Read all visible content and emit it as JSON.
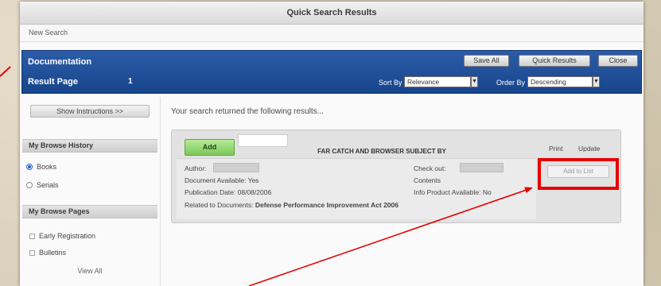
{
  "window": {
    "title": "Quick Search Results"
  },
  "subheader": {
    "new_search_link": "New Search"
  },
  "header": {
    "heading": "Documentation",
    "result_page_label": "Result Page",
    "result_page_value": "1",
    "buttons": {
      "save_all": "Save All",
      "quick_results": "Quick Results",
      "close": "Close"
    },
    "sort_by": {
      "label": "Sort By",
      "value": "Relevance"
    },
    "order_by": {
      "label": "Order By",
      "value": "Descending"
    }
  },
  "sidebar": {
    "instructions_button": "Show Instructions >>",
    "sections": [
      {
        "title": "My Browse History",
        "items": [
          {
            "label": "Books",
            "selected": true
          },
          {
            "label": "Serials",
            "selected": false
          }
        ]
      },
      {
        "title": "My Browse Pages",
        "items": [
          {
            "label": "Early Registration"
          },
          {
            "label": "Bulletins"
          }
        ],
        "footer": "View All"
      }
    ]
  },
  "main": {
    "summary": "Your search returned the following results...",
    "result": {
      "add_button": "Add",
      "title": "FAR CATCH AND BROWSER SUBJECT BY",
      "actions": {
        "print": "Print",
        "update": "Update"
      },
      "left_fields": [
        {
          "label": "Author:"
        },
        {
          "label": "Document Available:",
          "value": "Yes"
        },
        {
          "label": "Publication Date:",
          "value": "08/08/2006"
        },
        {
          "label": "Related to Documents:",
          "value": "Defense Performance Improvement Act 2006"
        }
      ],
      "right_fields": [
        {
          "label": "Check out:"
        },
        {
          "label": "Contents"
        },
        {
          "label": "Info Product Available:",
          "value": "No"
        }
      ],
      "add_to_list_button": "Add to List"
    }
  },
  "colors": {
    "header_blue": "#1f4f95",
    "add_green": "#8fd46c",
    "annotation_red": "#e60000"
  }
}
